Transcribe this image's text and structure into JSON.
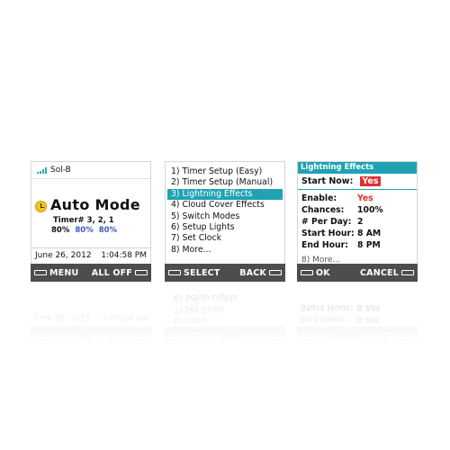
{
  "screens": {
    "status": {
      "device_name": "Sol-B",
      "mode_title": "Auto Mode",
      "timer_text": "Timer# 3, 2, 1",
      "percentages": [
        "80%",
        "80%",
        "80%"
      ],
      "date": "June 26, 2012",
      "time": "1:04:58 PM",
      "left_softkey": "MENU",
      "right_softkey": "ALL OFF"
    },
    "menu": {
      "items": [
        "1) Timer Setup (Easy)",
        "2) Timer Setup (Manual)",
        "3) Lightning Effects",
        "4) Cloud Cover Effects",
        "5) Switch Modes",
        "6) Setup Lights",
        "7) Set Clock",
        "8) More..."
      ],
      "selected_index": 2,
      "left_softkey": "SELECT",
      "right_softkey": "BACK"
    },
    "lightning": {
      "title": "Lightning Effects",
      "start_now_label": "Start Now:",
      "start_now_value": "Yes",
      "settings": [
        {
          "label": "Enable:",
          "value": "Yes"
        },
        {
          "label": "Chances:",
          "value": "100%"
        },
        {
          "label": "# Per Day:",
          "value": "2"
        },
        {
          "label": "Start Hour:",
          "value": "8 AM"
        },
        {
          "label": "End Hour:",
          "value": "8 PM"
        }
      ],
      "background_peek": "8) More...",
      "left_softkey": "OK",
      "right_softkey": "CANCEL"
    }
  },
  "colors": {
    "accent": "#1fa3b2",
    "highlight": "#e03030",
    "softbar": "#4d4d4d",
    "clock": "#f6c21c",
    "percent_blue": "#3a5bbf"
  }
}
